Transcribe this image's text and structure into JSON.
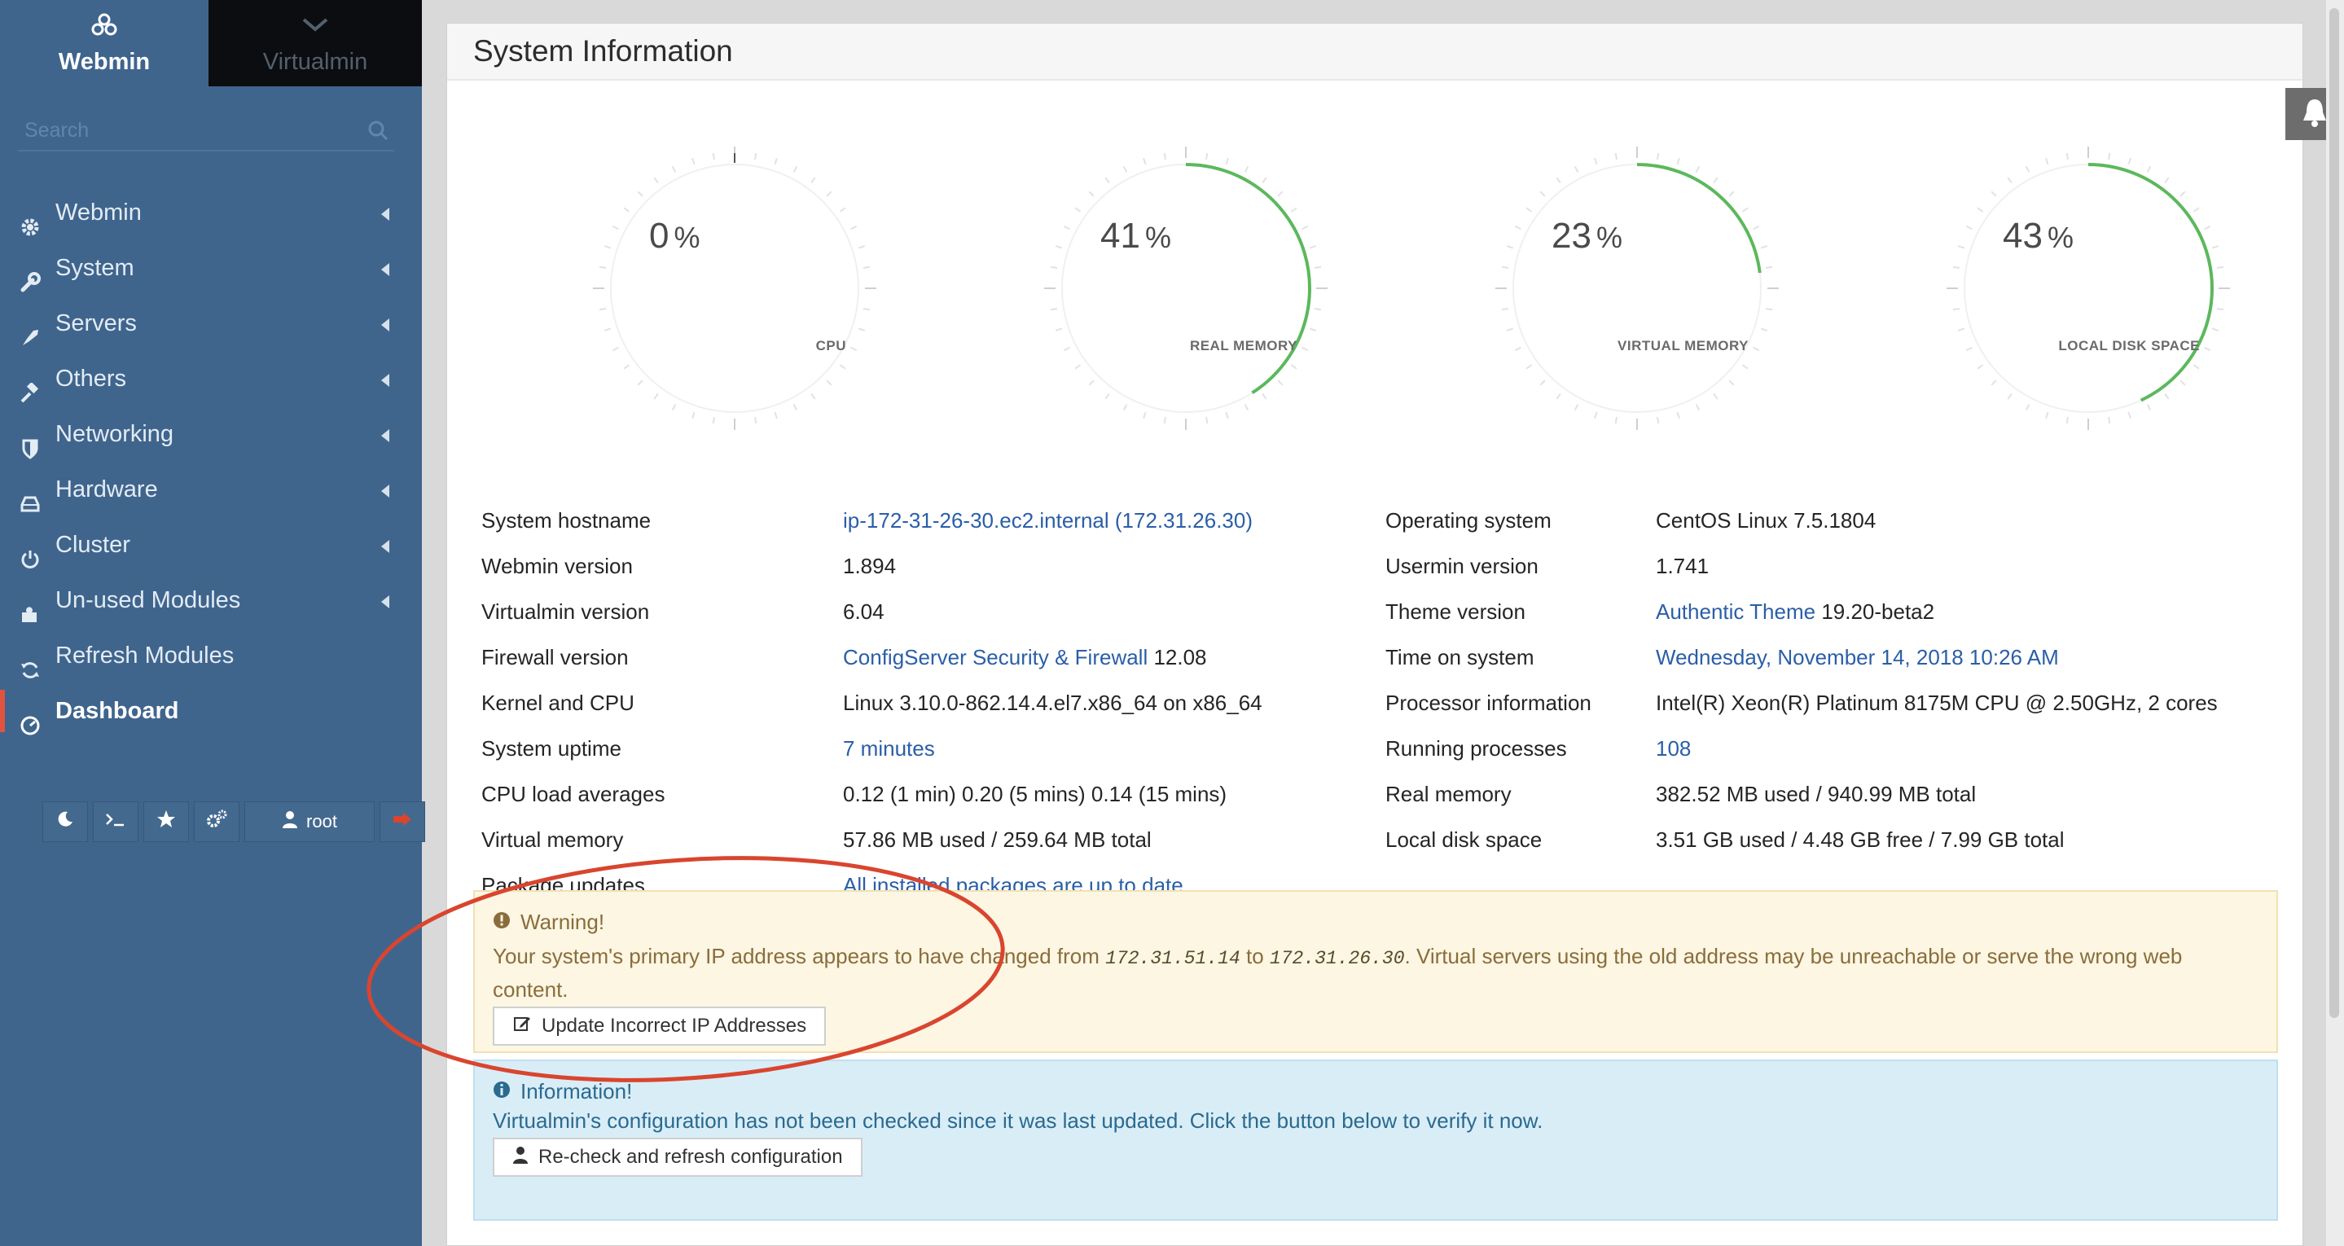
{
  "sidebar": {
    "tabs": [
      {
        "label": "Webmin"
      },
      {
        "label": "Virtualmin"
      }
    ],
    "search_placeholder": "Search",
    "items": [
      {
        "label": "Webmin",
        "icon": "gear-icon"
      },
      {
        "label": "System",
        "icon": "wrench-icon"
      },
      {
        "label": "Servers",
        "icon": "rocket-icon"
      },
      {
        "label": "Others",
        "icon": "gavel-icon"
      },
      {
        "label": "Networking",
        "icon": "shield-icon"
      },
      {
        "label": "Hardware",
        "icon": "hdd-icon"
      },
      {
        "label": "Cluster",
        "icon": "power-icon"
      },
      {
        "label": "Un-used Modules",
        "icon": "puzzle-icon"
      },
      {
        "label": "Refresh Modules",
        "icon": "refresh-icon"
      },
      {
        "label": "Dashboard",
        "icon": "dashboard-icon"
      }
    ],
    "toolbar": {
      "user": "root"
    }
  },
  "panel": {
    "title": "System Information",
    "gauges": [
      {
        "value": "0",
        "unit": "%",
        "label": "CPU",
        "percent": 0
      },
      {
        "value": "41",
        "unit": "%",
        "label": "REAL MEMORY",
        "percent": 41
      },
      {
        "value": "23",
        "unit": "%",
        "label": "VIRTUAL MEMORY",
        "percent": 23
      },
      {
        "value": "43",
        "unit": "%",
        "label": "LOCAL DISK SPACE",
        "percent": 43
      }
    ],
    "left_info": [
      {
        "key": "System hostname",
        "value": "ip-172-31-26-30.ec2.internal (172.31.26.30)"
      },
      {
        "key": "Webmin version",
        "value": "1.894"
      },
      {
        "key": "Virtualmin version",
        "value": "6.04"
      },
      {
        "key": "Firewall version",
        "link": "ConfigServer Security & Firewall",
        "value": " 12.08"
      },
      {
        "key": "Kernel and CPU",
        "value": "Linux 3.10.0-862.14.4.el7.x86_64 on x86_64"
      },
      {
        "key": "System uptime",
        "value": "7 minutes"
      },
      {
        "key": "CPU load averages",
        "value": "0.12 (1 min) 0.20 (5 mins) 0.14 (15 mins)"
      },
      {
        "key": "Virtual memory",
        "value": "57.86 MB used / 259.64 MB total"
      },
      {
        "key": "Package updates",
        "value": "All installed packages are up to date"
      }
    ],
    "right_info": [
      {
        "key": "Operating system",
        "value": "CentOS Linux 7.5.1804"
      },
      {
        "key": "Usermin version",
        "value": "1.741"
      },
      {
        "key": "Theme version",
        "link": "Authentic Theme",
        "value": " 19.20-beta2"
      },
      {
        "key": "Time on system",
        "value": "Wednesday, November 14, 2018 10:26 AM"
      },
      {
        "key": "Processor information",
        "value": "Intel(R) Xeon(R) Platinum 8175M CPU @ 2.50GHz, 2 cores"
      },
      {
        "key": "Running processes",
        "value": "108"
      },
      {
        "key": "Real memory",
        "value": "382.52 MB used / 940.99 MB total"
      },
      {
        "key": "Local disk space",
        "value": "3.51 GB used / 4.48 GB free / 7.99 GB total"
      }
    ],
    "warning": {
      "title": "Warning!",
      "text_before": "Your system's primary IP address appears to have changed from ",
      "old_ip": "172.31.51.14",
      "text_mid": " to ",
      "new_ip": "172.31.26.30",
      "text_after": ". Virtual servers using the old address may be unreachable or serve the wrong web content.",
      "button": "Update Incorrect IP Addresses"
    },
    "information": {
      "title": "Information!",
      "text": "Virtualmin's configuration has not been checked since it was last updated. Click the button below to verify it now.",
      "button": "Re-check and refresh configuration"
    }
  },
  "colors": {
    "sidebar_bg": "#3f658d",
    "gauge_arc": "#5cb85c",
    "active_marker": "#e0543f",
    "annotation": "#d9452f"
  }
}
